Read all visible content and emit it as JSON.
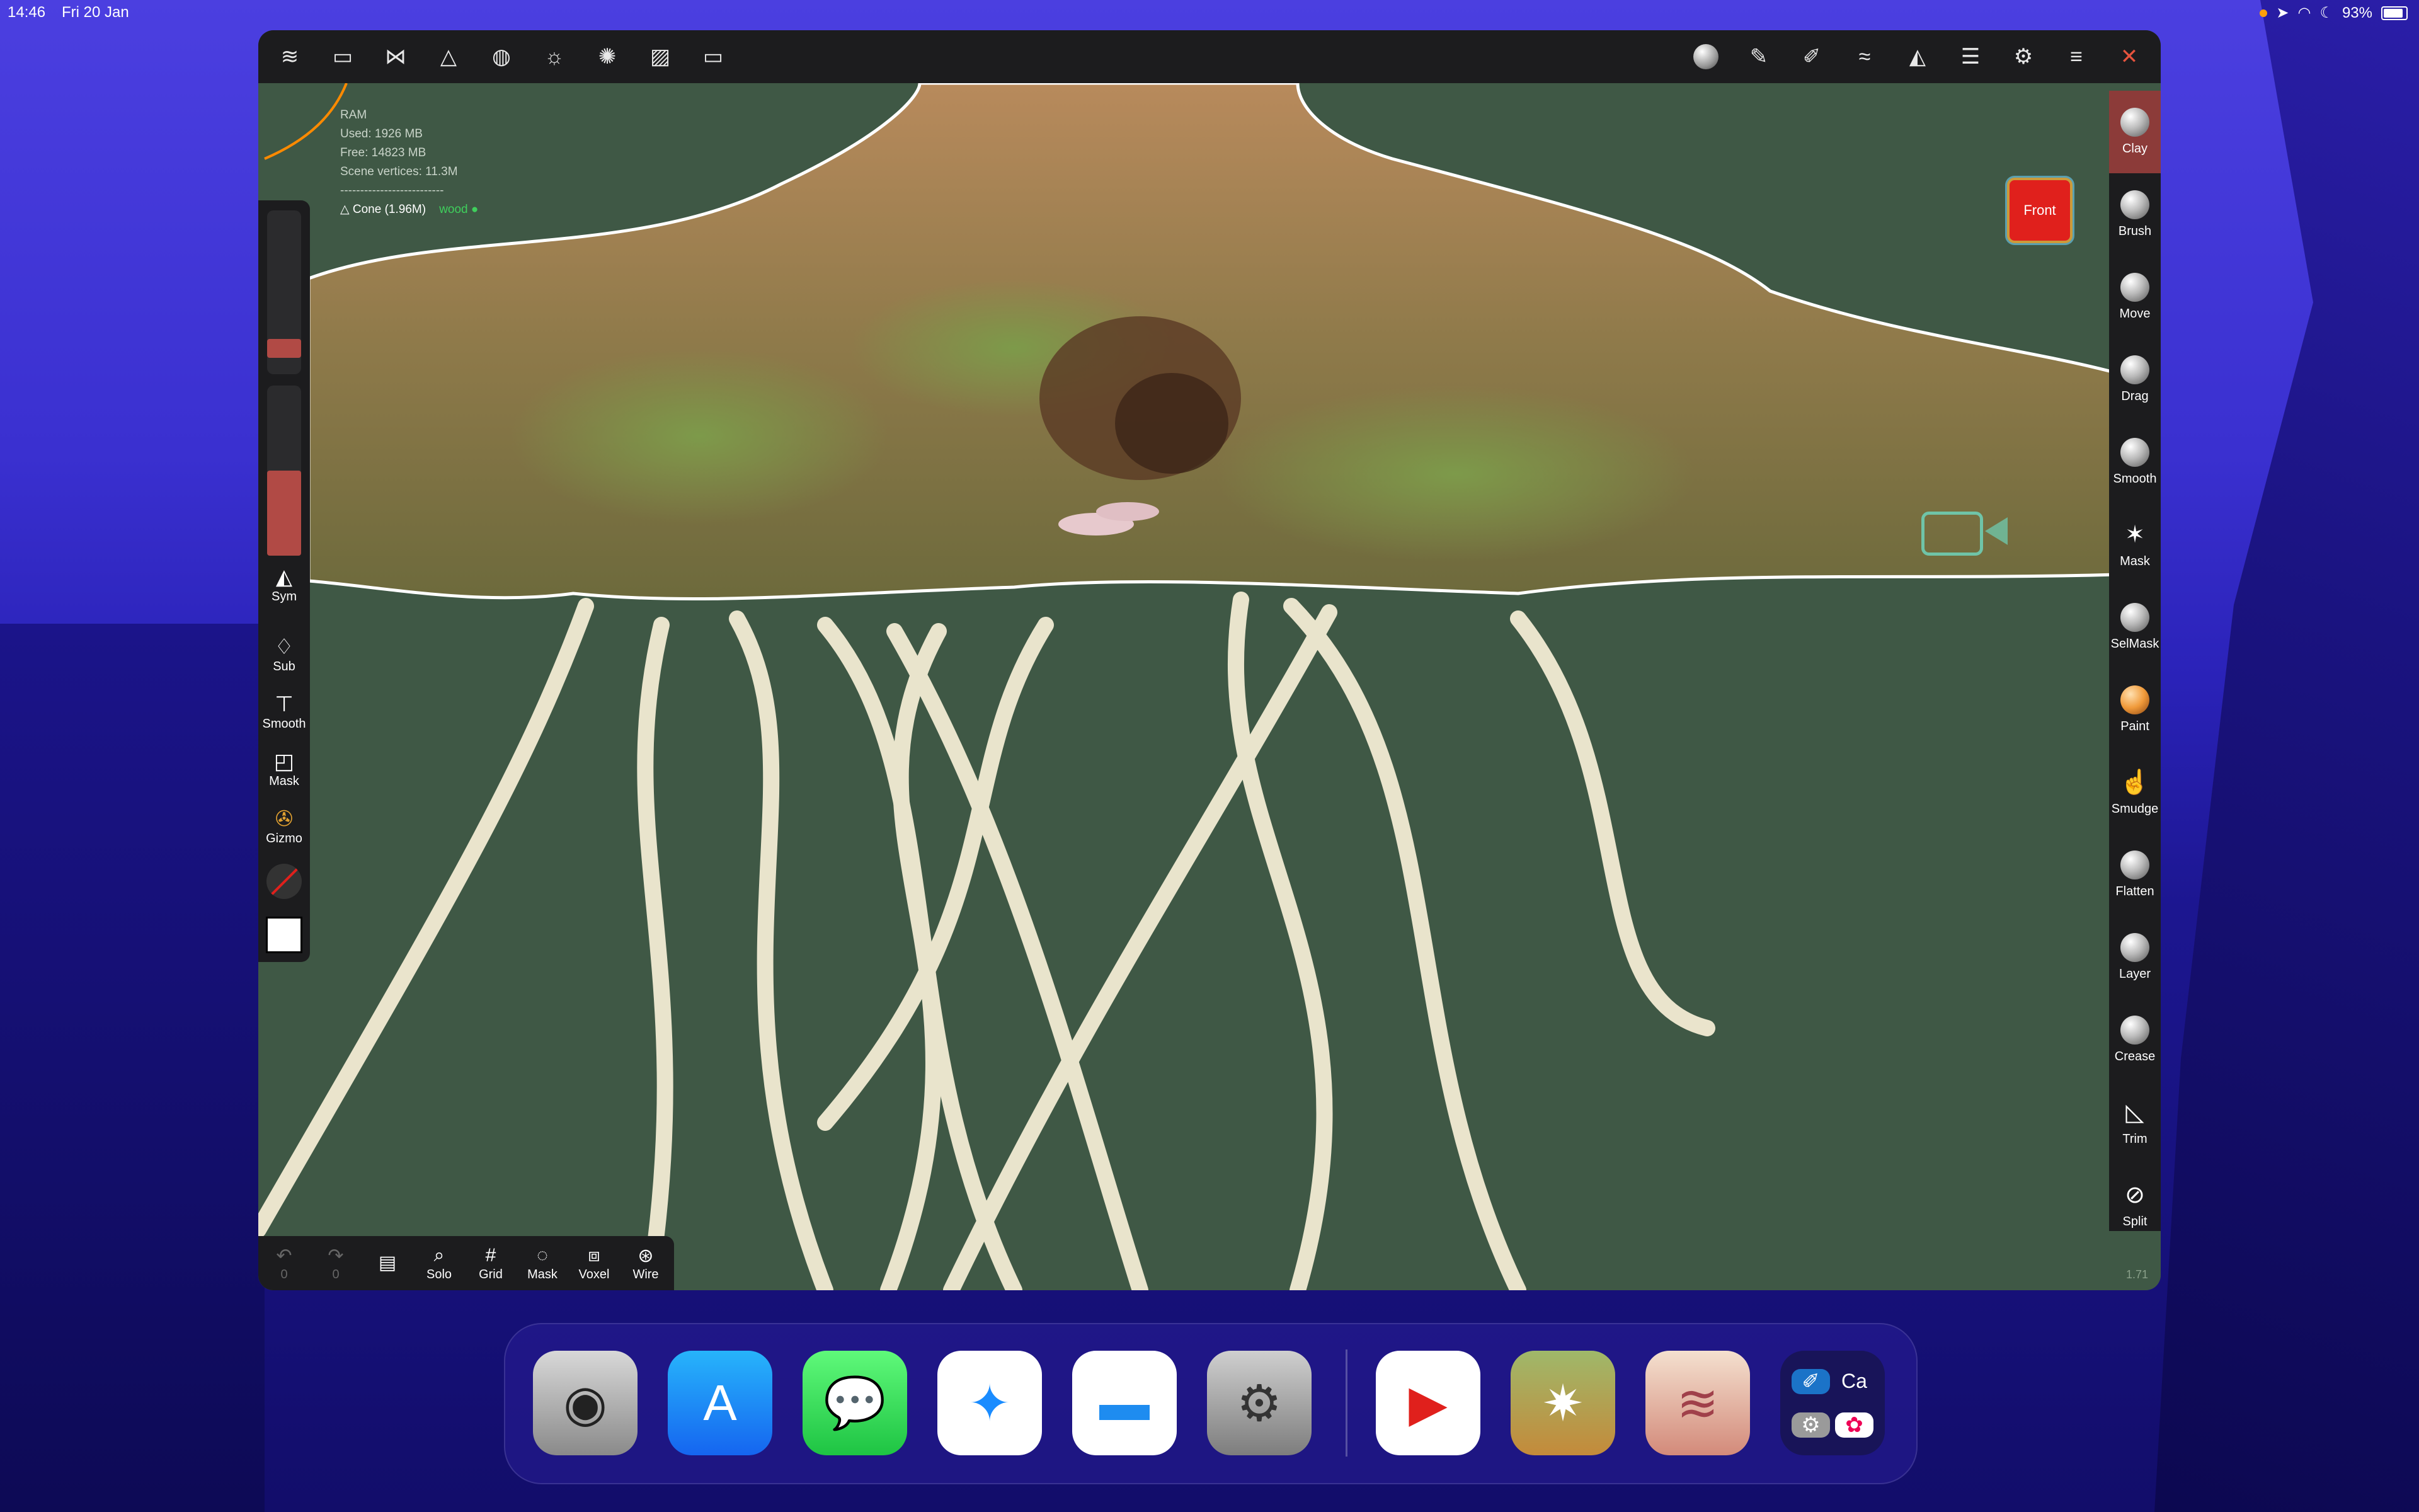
{
  "statusbar": {
    "time": "14:46",
    "date": "Fri 20 Jan",
    "battery": "93%"
  },
  "topbar": {
    "left_icons": [
      "nomad-logo-icon",
      "folder-icon",
      "scene-graph-icon",
      "topology-icon",
      "material-icon",
      "light-icon",
      "environment-icon",
      "image-icon",
      "camera-icon"
    ],
    "right_icons": [
      "material-sphere-icon",
      "brush-icon",
      "pen-icon",
      "stroke-icon",
      "symmetry-icon",
      "layers-icon",
      "settings-icon",
      "menu-icon",
      "tools-icon"
    ]
  },
  "info": {
    "ram_label": "RAM",
    "used": "Used: 1926 MB",
    "free": "Free: 14823 MB",
    "scene_vertices": "Scene vertices: 11.3M",
    "divider": "--------------------------",
    "object": "Cone (1.96M)",
    "material": "wood"
  },
  "left_panel": {
    "sym": "Sym",
    "sub": "Sub",
    "smooth": "Smooth",
    "mask": "Mask",
    "gizmo": "Gizmo",
    "slider_top_level": 0.1,
    "slider_bottom_level": 0.5
  },
  "right_tools": [
    {
      "label": "Clay",
      "active": true
    },
    {
      "label": "Brush"
    },
    {
      "label": "Move"
    },
    {
      "label": "Drag"
    },
    {
      "label": "Smooth"
    },
    {
      "label": "Mask"
    },
    {
      "label": "SelMask"
    },
    {
      "label": "Paint"
    },
    {
      "label": "Smudge"
    },
    {
      "label": "Flatten"
    },
    {
      "label": "Layer"
    },
    {
      "label": "Crease"
    },
    {
      "label": "Trim"
    },
    {
      "label": "Split"
    }
  ],
  "view_cube": "Front",
  "bottom_bar": {
    "undo_count": "0",
    "redo_count": "0",
    "solo": "Solo",
    "grid": "Grid",
    "mask": "Mask",
    "voxel": "Voxel",
    "wire": "Wire"
  },
  "version": "1.71",
  "dock": {
    "apps": [
      "Camera",
      "App Store",
      "Messages",
      "Safari",
      "Files",
      "Settings",
      "YouTube",
      "Game",
      "Nomad Sculpt"
    ],
    "folder_label": "Ca"
  },
  "colors": {
    "accent_active": "#8c3b39",
    "viewport_bg": "#3f5845",
    "toolbar_bg": "#1c1c1e"
  }
}
